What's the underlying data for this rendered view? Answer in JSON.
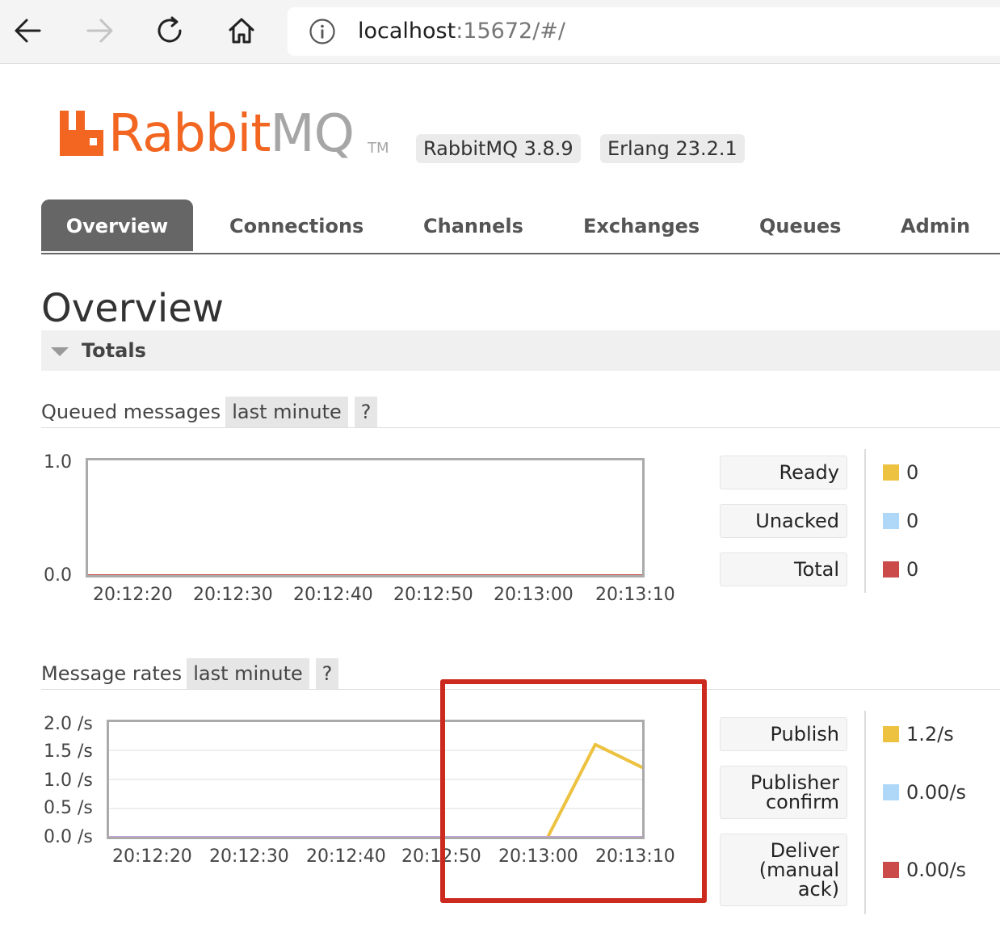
{
  "browser": {
    "url_host": "localhost",
    "url_rest": ":15672/#/",
    "icons": [
      "back-arrow-icon",
      "forward-arrow-icon",
      "reload-icon",
      "home-icon",
      "info-icon"
    ]
  },
  "header": {
    "logo_rabbit": "Rabbit",
    "logo_mq": "MQ",
    "logo_tm": "TM",
    "version_rabbitmq": "RabbitMQ 3.8.9",
    "version_erlang": "Erlang 23.2.1",
    "brand_color": "#f26622"
  },
  "tabs": [
    {
      "label": "Overview",
      "active": true
    },
    {
      "label": "Connections",
      "active": false
    },
    {
      "label": "Channels",
      "active": false
    },
    {
      "label": "Exchanges",
      "active": false
    },
    {
      "label": "Queues",
      "active": false
    },
    {
      "label": "Admin",
      "active": false
    }
  ],
  "page": {
    "title": "Overview",
    "totals_label": "Totals"
  },
  "queued": {
    "label": "Queued messages",
    "range": "last minute",
    "help": "?",
    "legend": [
      {
        "label": "Ready",
        "value": "0",
        "color": "#edc240"
      },
      {
        "label": "Unacked",
        "value": "0",
        "color": "#afd8f8"
      },
      {
        "label": "Total",
        "value": "0",
        "color": "#cb4b4b"
      }
    ]
  },
  "rates": {
    "label": "Message rates",
    "range": "last minute",
    "help": "?",
    "legend": [
      {
        "label": "Publish",
        "value": "1.2/s",
        "color": "#edc240"
      },
      {
        "label": "Publisher\nconfirm",
        "value": "0.00/s",
        "color": "#afd8f8"
      },
      {
        "label": "Deliver\n(manual\nack)",
        "value": "0.00/s",
        "color": "#cb4b4b"
      }
    ]
  },
  "highlight_color": "#cc2a1e",
  "chart_data": [
    {
      "type": "line",
      "name": "queued-messages",
      "x_ticks": [
        "20:12:20",
        "20:12:30",
        "20:12:40",
        "20:12:50",
        "20:13:00",
        "20:13:10"
      ],
      "y_ticks": [
        "1.0",
        "0.0"
      ],
      "ylim": [
        0,
        1
      ],
      "grid": false,
      "series": [
        {
          "name": "Total",
          "color": "#cb4b4b",
          "x": [
            "20:12:15",
            "20:13:15"
          ],
          "y": [
            0,
            0
          ]
        }
      ]
    },
    {
      "type": "line",
      "name": "message-rates",
      "x_ticks": [
        "20:12:20",
        "20:12:30",
        "20:12:40",
        "20:12:50",
        "20:13:00",
        "20:13:10"
      ],
      "y_ticks": [
        "2.0 /s",
        "1.5 /s",
        "1.0 /s",
        "0.5 /s",
        "0.0 /s"
      ],
      "ylim": [
        0,
        2
      ],
      "grid": true,
      "series": [
        {
          "name": "Publish",
          "color": "#edc240",
          "x": [
            "20:13:01",
            "20:13:06",
            "20:13:11"
          ],
          "y": [
            0,
            1.6,
            1.2
          ]
        },
        {
          "name": "Deliver (manual ack)",
          "color": "#c9a0dc",
          "x": [
            "20:12:15",
            "20:13:11"
          ],
          "y": [
            0,
            0
          ]
        }
      ]
    }
  ]
}
